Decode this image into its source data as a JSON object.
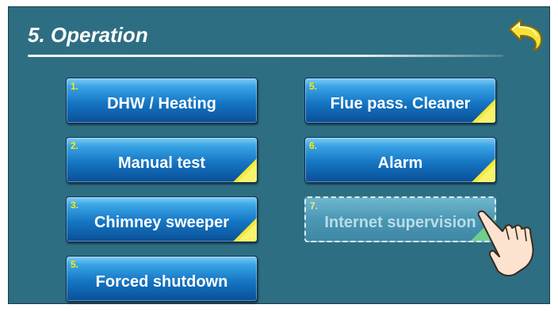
{
  "header": {
    "title": "5. Operation",
    "back_icon": "back-arrow-icon"
  },
  "menu": {
    "left": [
      {
        "num": "1.",
        "label": "DHW / Heating",
        "has_corner": false
      },
      {
        "num": "2.",
        "label": "Manual test",
        "has_corner": true
      },
      {
        "num": "3.",
        "label": "Chimney sweeper",
        "has_corner": true
      },
      {
        "num": "5.",
        "label": "Forced shutdown",
        "has_corner": false
      }
    ],
    "right": [
      {
        "num": "5.",
        "label": "Flue pass. Cleaner",
        "has_corner": true
      },
      {
        "num": "6.",
        "label": "Alarm",
        "has_corner": true
      },
      {
        "num": "7.",
        "label": "Internet supervision",
        "has_corner": true,
        "disabled": true
      }
    ]
  },
  "colors": {
    "background": "#2e6e82",
    "button_blue": "#1576c4",
    "number_yellow": "#ffea00",
    "corner_yellow": "#f2ea3a"
  },
  "icons": {
    "pointer": "hand-pointer-icon",
    "corner": "corner-triangle-icon"
  }
}
